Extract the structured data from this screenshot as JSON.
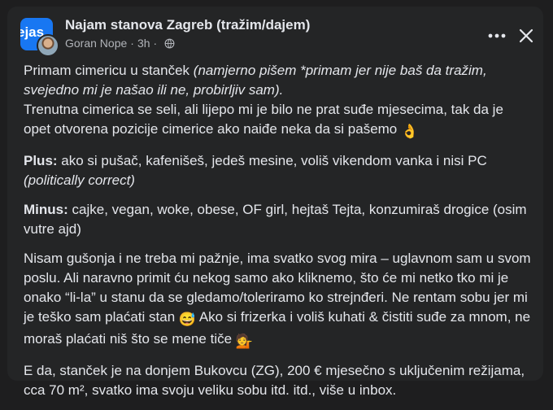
{
  "post": {
    "group_name": "Najam stanova Zagreb (tražim/dajem)",
    "group_logo_text": "ejas",
    "author": "Goran Nope",
    "time": "3h",
    "separator": "·",
    "privacy_icon": "globe-icon",
    "more_icon": "more-horizontal-icon",
    "close_icon": "close-icon"
  },
  "body": {
    "p1_text": "Primam cimericu u stanček ",
    "p1_italic": "(namjerno pišem *primam jer nije baš da tražim, svejedno mi je našao ili ne, probirljiv sam).",
    "p1_cont": "Trenutna cimerica se seli, ali lijepo mi je bilo ne prat suđe mjesecima, tak da je opet otvorena pozicije cimerice ako naiđe neka da si pašemo",
    "p1_emoji": "👌",
    "p2_label": "Plus:",
    "p2_text": " ako si pušač, kafenišeš, jedeš mesine, voliš vikendom vanka i nisi PC ",
    "p2_italic": "(politically correct)",
    "p3_label": "Minus:",
    "p3_text": " cajke, vegan, woke, obese, OF girl, hejtaš Tejta, konzumiraš drogice (osim vutre ajd)",
    "p4_text_a": "Nisam gušonja i ne treba mi pažnje, ima svatko svog mira – uglavnom sam u svom poslu. Ali naravno primit ću nekog samo ako kliknemo, što će mi netko tko mi je onako “li-la” u stanu da se gledamo/toleriramo ko strejnđeri. Ne rentam sobu jer mi je teško sam plaćati stan",
    "p4_emoji_a": "😅",
    "p4_text_b": " Ako si frizerka i voliš kuhati & čistiti suđe za mnom, ne moraš plaćati niš što se mene tiče",
    "p4_emoji_b": "💁",
    "p5_text": "E da, stanček je na donjem Bukovcu (ZG), 200 € mjesečno s uključenim režijama, cca 70 m², svatko ima svoju veliku sobu itd. itd., više u inbox."
  }
}
